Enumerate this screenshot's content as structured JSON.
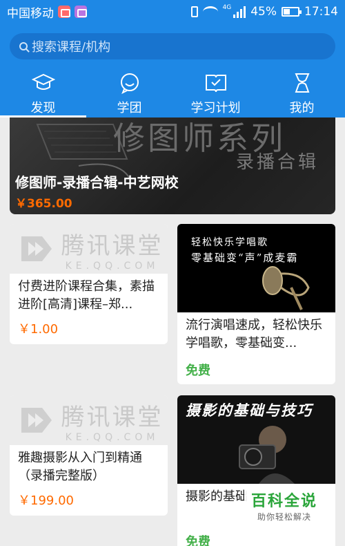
{
  "status_bar": {
    "carrier": "中国移动",
    "network": "4G",
    "battery": "45%",
    "time": "17:14"
  },
  "search": {
    "placeholder": "搜索课程/机构"
  },
  "tabs": [
    {
      "label": "发现",
      "icon": "graduation-cap-icon",
      "active": true
    },
    {
      "label": "学团",
      "icon": "chat-bubble-icon",
      "active": false
    },
    {
      "label": "学习计划",
      "icon": "book-check-icon",
      "active": false
    },
    {
      "label": "我的",
      "icon": "person-icon",
      "active": false
    }
  ],
  "banner": {
    "image_text_big": "修图师系列",
    "image_text_sub": "录播合辑",
    "title": "修图师-录播合辑-中艺网校",
    "price": "￥365.00"
  },
  "cards": [
    {
      "thumb_type": "tencent-placeholder",
      "logo_text": "腾讯课堂",
      "logo_sub": "KE.QQ.COM",
      "title": "付费进阶课程合集，素描进阶[高清]课程–郑...",
      "price": "￥1.00"
    },
    {
      "thumb_type": "singing",
      "thumb_line1": "轻松快乐学唱歌",
      "thumb_line2": "零基础变“声”成麦霸",
      "title": "流行演唱速成，轻松快乐学唱歌，零基础变...",
      "price": "免费"
    },
    {
      "thumb_type": "tencent-placeholder",
      "logo_text": "腾讯课堂",
      "logo_sub": "KE.QQ.COM",
      "title": "雅趣摄影从入门到精通（录播完整版）",
      "price": "￥199.00"
    },
    {
      "thumb_type": "photography",
      "thumb_title": "摄影的基础与技巧",
      "title": "摄影的基础",
      "price": "免费"
    }
  ],
  "watermark": {
    "main": "百科全说",
    "sub": "助你轻松解决"
  },
  "colors": {
    "brand_blue": "#1e88e5",
    "price_orange": "#ff6a00",
    "free_green": "#43b049"
  }
}
